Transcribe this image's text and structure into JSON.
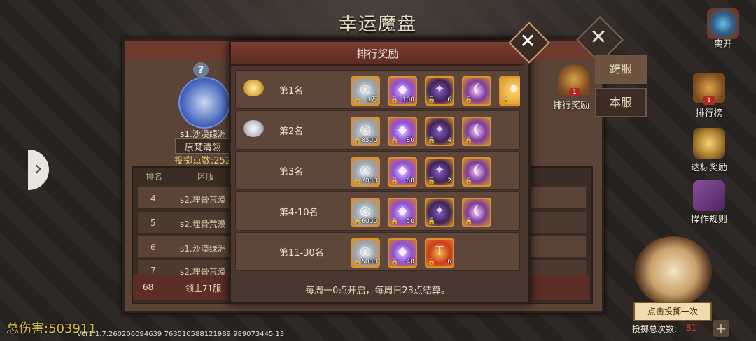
{
  "game_title": "幸运魔盘",
  "subtitle": "",
  "player": {
    "server": "s1.沙漠绿洲",
    "name": "原梵清翎",
    "throw_points": "投掷点数:252"
  },
  "rank_table": {
    "headers": [
      "排名",
      "区服"
    ],
    "rows": [
      {
        "rank": "4",
        "server": "s2.埋骨荒漠"
      },
      {
        "rank": "5",
        "server": "s2.埋骨荒漠"
      },
      {
        "rank": "6",
        "server": "s1.沙漠绿洲"
      },
      {
        "rank": "7",
        "server": "s2.埋骨荒漠"
      }
    ],
    "my_row": {
      "rank": "68",
      "server": "领主71服"
    }
  },
  "modal": {
    "title": "排行奖励",
    "footer": "每周一0点开启，每周日23点结算。",
    "rows": [
      {
        "label": "第1名",
        "badge": "gold",
        "items": [
          {
            "type": "coin",
            "count": "1万"
          },
          {
            "type": "gem",
            "count": "100"
          },
          {
            "type": "claw",
            "count": "6"
          },
          {
            "type": "bow",
            "count": ""
          },
          {
            "type": "flame",
            "count": ""
          }
        ]
      },
      {
        "label": "第2名",
        "badge": "silver",
        "items": [
          {
            "type": "coin",
            "count": "8500"
          },
          {
            "type": "gem",
            "count": "80"
          },
          {
            "type": "claw",
            "count": "4"
          },
          {
            "type": "bow",
            "count": ""
          }
        ]
      },
      {
        "label": "第3名",
        "badge": "",
        "items": [
          {
            "type": "coin",
            "count": "7000"
          },
          {
            "type": "gem",
            "count": "60"
          },
          {
            "type": "claw",
            "count": "2"
          },
          {
            "type": "bow",
            "count": ""
          }
        ]
      },
      {
        "label": "第4-10名",
        "badge": "",
        "items": [
          {
            "type": "coin",
            "count": "6000"
          },
          {
            "type": "gem",
            "count": "50"
          },
          {
            "type": "claw",
            "count": ""
          },
          {
            "type": "bow",
            "count": ""
          }
        ]
      },
      {
        "label": "第11-30名",
        "badge": "",
        "items": [
          {
            "type": "coin",
            "count": "5000"
          },
          {
            "type": "gem",
            "count": "40"
          },
          {
            "type": "scroll",
            "count": "6"
          }
        ]
      }
    ]
  },
  "tabs": {
    "cross_server": "跨服",
    "this_server": "本服",
    "active": "cross_server"
  },
  "rank_reward": {
    "label": "排行奖励",
    "badge": "1"
  },
  "right_menu": {
    "leave": "离开",
    "ranking": "排行榜",
    "ranking_badge": "1",
    "target_reward": "达标奖励",
    "rules": "操作规则"
  },
  "throw": {
    "button": "点击投掷一次",
    "total_label": "投掷总次数:",
    "total_value": "81"
  },
  "total_damage": "总伤害:503911",
  "version": "Ver1.1.7.260206094639  763510588121989  989073445 13"
}
